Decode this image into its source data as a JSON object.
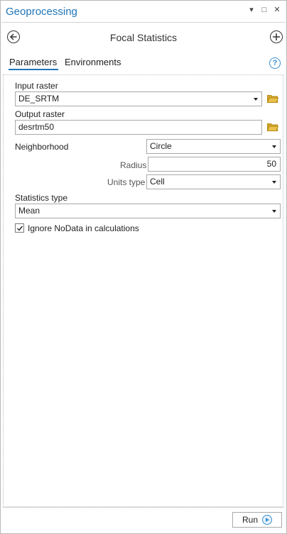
{
  "pane": {
    "title": "Geoprocessing",
    "controls": {
      "menu": "▾",
      "maximize": "□",
      "close": "✕"
    }
  },
  "tool": {
    "title": "Focal Statistics",
    "back_icon": "back-arrow-icon",
    "add_icon": "add-icon"
  },
  "tabs": [
    {
      "label": "Parameters",
      "active": true
    },
    {
      "label": "Environments",
      "active": false
    }
  ],
  "help": {
    "icon": "help-icon",
    "label": "?"
  },
  "params": {
    "input_raster": {
      "label": "Input raster",
      "value": "DE_SRTM"
    },
    "output_raster": {
      "label": "Output raster",
      "value": "desrtm50"
    },
    "neighborhood": {
      "label": "Neighborhood",
      "value": "Circle"
    },
    "radius": {
      "label": "Radius",
      "value": "50"
    },
    "units_type": {
      "label": "Units type",
      "value": "Cell"
    },
    "statistics_type": {
      "label": "Statistics type",
      "value": "Mean"
    },
    "ignore_nodata": {
      "label": "Ignore NoData in calculations",
      "checked": true
    }
  },
  "footer": {
    "run_label": "Run"
  },
  "colors": {
    "accent": "#1f76b8",
    "folder": "#d4a72c"
  }
}
